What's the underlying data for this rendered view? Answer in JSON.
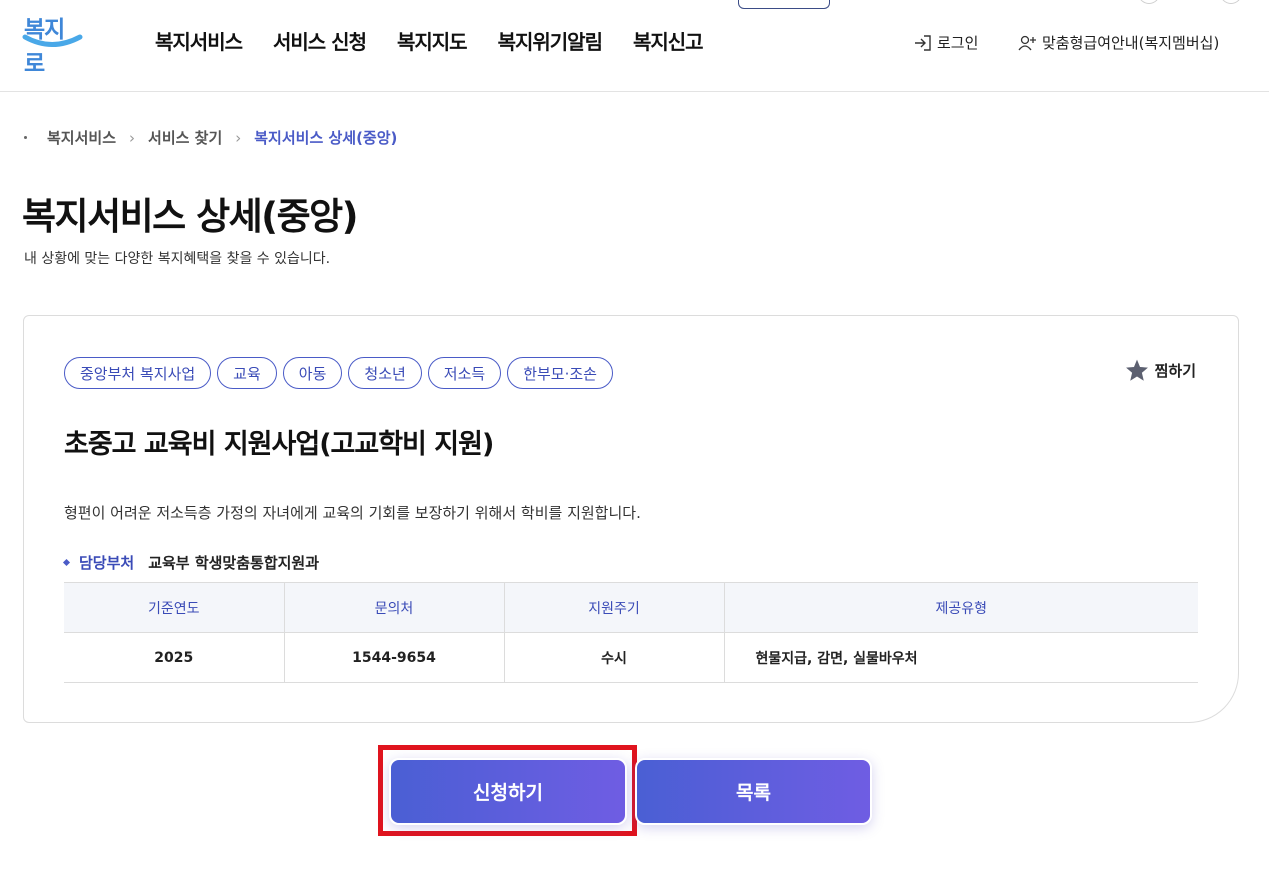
{
  "header": {
    "logo_text": "복지로",
    "nav": [
      "복지서비스",
      "서비스 신청",
      "복지지도",
      "복지위기알림",
      "복지신고"
    ],
    "login_label": "로그인",
    "membership_label": "맞춤형급여안내(복지멤버십)",
    "icons": {
      "login": "login-icon",
      "membership": "user-plus-icon"
    }
  },
  "breadcrumb": {
    "items": [
      "복지서비스",
      "서비스 찾기"
    ],
    "current": "복지서비스 상세(중앙)"
  },
  "page": {
    "title": "복지서비스 상세(중앙)",
    "subtitle": "내 상황에 맞는 다양한 복지혜택을 찾을 수 있습니다."
  },
  "service": {
    "tags": [
      "중앙부처 복지사업",
      "교육",
      "아동",
      "청소년",
      "저소득",
      "한부모·조손"
    ],
    "favorite_label": "찜하기",
    "title": "초중고 교육비 지원사업(고교학비 지원)",
    "description": "형편이 어려운 저소득층 가정의 자녀에게 교육의 기회를 보장하기 위해서 학비를 지원합니다.",
    "dept_label": "담당부처",
    "dept_value": "교육부 학생맞춤통합지원과",
    "table": {
      "headers": [
        "기준연도",
        "문의처",
        "지원주기",
        "제공유형"
      ],
      "row": [
        "2025",
        "1544-9654",
        "수시",
        "현물지급, 감면, 실물바우처"
      ]
    }
  },
  "actions": {
    "apply_label": "신청하기",
    "list_label": "목록"
  },
  "colors": {
    "accent": "#4a5bc7",
    "button_start": "#4a5fd4",
    "button_end": "#6f5de3",
    "highlight": "#e0141e"
  }
}
